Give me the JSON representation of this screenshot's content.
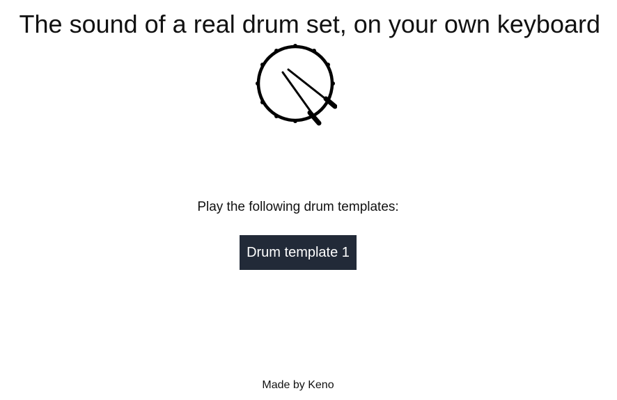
{
  "header": {
    "title": "The sound of a real drum set, on your own keyboard",
    "logo_icon": "drum-with-sticks-icon"
  },
  "main": {
    "prompt": "Play the following drum templates:",
    "templates": [
      {
        "label": "Drum template 1"
      }
    ]
  },
  "footer": {
    "credit": "Made by Keno"
  },
  "colors": {
    "background": "#ffffff",
    "text": "#111111",
    "button_background": "#222a38",
    "button_text": "#ffffff"
  }
}
